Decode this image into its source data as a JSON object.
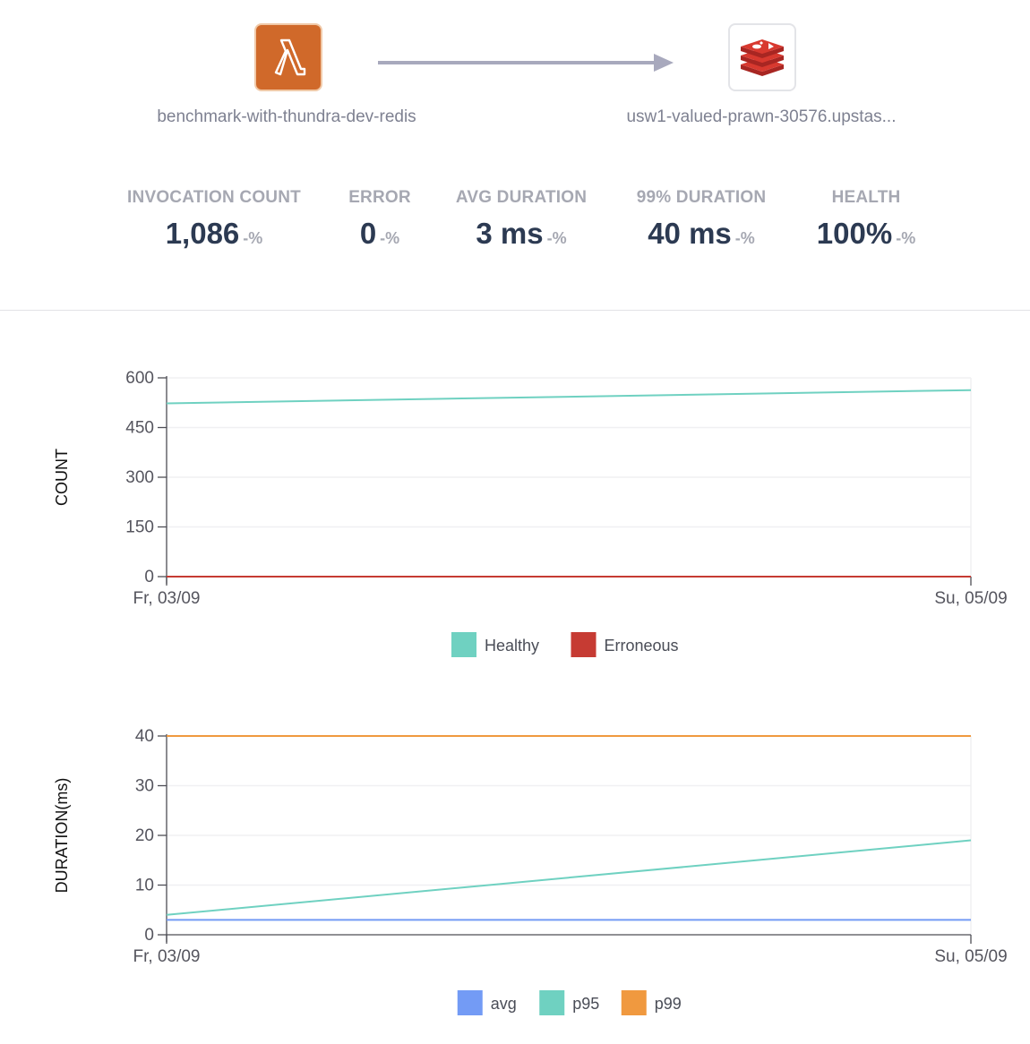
{
  "graph": {
    "source": {
      "name": "benchmark-with-thundra-dev-redis",
      "icon": "aws-lambda-icon",
      "color": "#d0692a"
    },
    "target": {
      "name": "usw1-valued-prawn-30576.upstas...",
      "icon": "redis-icon",
      "color": "#c4312c"
    }
  },
  "stats": [
    {
      "title": "INVOCATION COUNT",
      "value": "1,086",
      "change": "-%"
    },
    {
      "title": "ERROR",
      "value": "0",
      "change": "-%"
    },
    {
      "title": "AVG DURATION",
      "value": "3 ms",
      "change": "-%"
    },
    {
      "title": "99% DURATION",
      "value": "40 ms",
      "change": "-%"
    },
    {
      "title": "HEALTH",
      "value": "100%",
      "change": "-%"
    }
  ],
  "chart_data": [
    {
      "type": "line",
      "ylabel": "COUNT",
      "xlabel": "",
      "x": [
        "Fr, 03/09",
        "Su, 05/09"
      ],
      "ylim": [
        0,
        600
      ],
      "yticks": [
        0,
        150,
        300,
        450,
        600
      ],
      "grid": true,
      "legend": "bottom",
      "series": [
        {
          "name": "Healthy",
          "color": "#6fd1c1",
          "values": [
            523,
            563
          ]
        },
        {
          "name": "Erroneous",
          "color": "#c63b33",
          "values": [
            0,
            0
          ]
        }
      ]
    },
    {
      "type": "line",
      "ylabel": "DURATION(ms)",
      "xlabel": "",
      "x": [
        "Fr, 03/09",
        "Su, 05/09"
      ],
      "ylim": [
        0,
        40
      ],
      "yticks": [
        0,
        10,
        20,
        30,
        40
      ],
      "grid": true,
      "legend": "bottom",
      "series": [
        {
          "name": "avg",
          "color": "#739bf5",
          "values": [
            3,
            3
          ]
        },
        {
          "name": "p95",
          "color": "#6fd1c1",
          "values": [
            4,
            19
          ]
        },
        {
          "name": "p99",
          "color": "#f0993f",
          "values": [
            40,
            40
          ]
        }
      ]
    }
  ]
}
